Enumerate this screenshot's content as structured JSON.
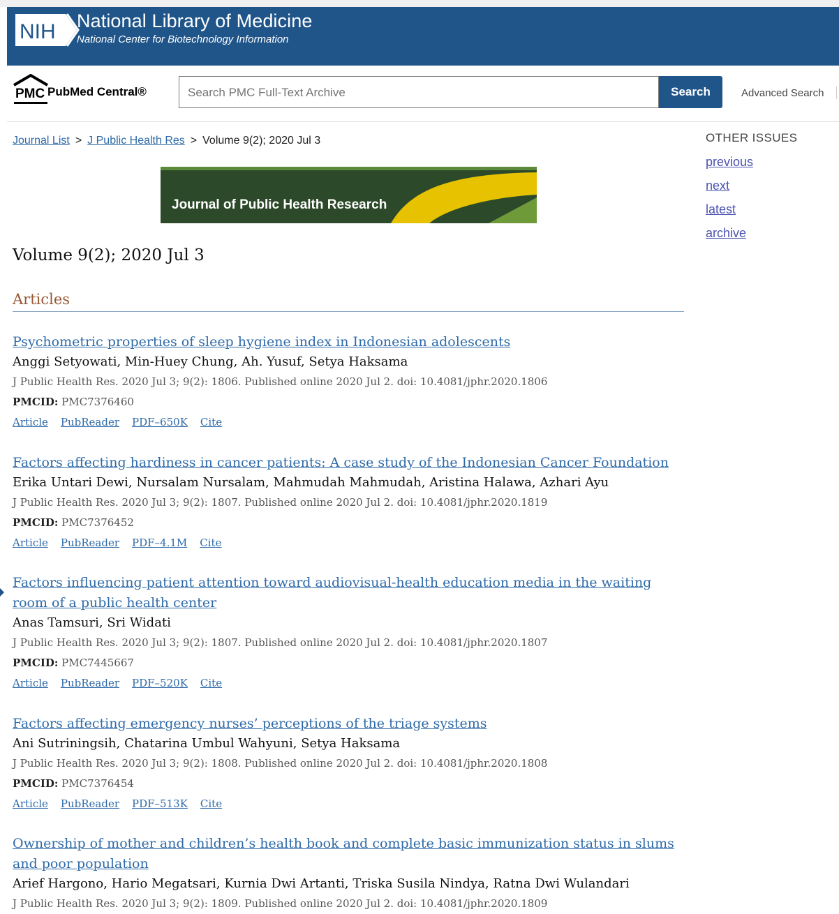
{
  "header": {
    "logo_text": "NIH",
    "title": "National Library of Medicine",
    "subtitle": "National Center for Biotechnology Information"
  },
  "pmc": {
    "logo_abbr": "PMC",
    "logo_name": "PubMed Central®",
    "search_placeholder": "Search PMC Full-Text Archive",
    "search_button": "Search",
    "advanced_search": "Advanced Search"
  },
  "breadcrumb": {
    "journal_list": "Journal List",
    "sep": ">",
    "journal": "J Public Health Res",
    "current": "Volume 9(2);  2020 Jul 3"
  },
  "journal_banner": "Journal of Public Health Research",
  "volume_heading": "Volume 9(2);  2020 Jul 3",
  "articles_heading": "Articles",
  "sidebar": {
    "title": "OTHER ISSUES",
    "links": [
      "previous",
      "next",
      "latest",
      "archive"
    ]
  },
  "articles": [
    {
      "title": "Psychometric properties of sleep hygiene index in Indonesian adolescents",
      "authors": "Anggi Setyowati, Min-Huey Chung, Ah. Yusuf, Setya Haksama",
      "citation": "J Public Health Res. 2020 Jul 3; 9(2): 1806. Published online 2020 Jul 2. doi: 10.4081/jphr.2020.1806",
      "pmcid_label": "PMCID:",
      "pmcid": "PMC7376460",
      "links": [
        "Article",
        "PubReader",
        "PDF–650K",
        "Cite"
      ]
    },
    {
      "title": "Factors affecting hardiness in cancer patients: A case study of the Indonesian Cancer Foundation",
      "authors": "Erika Untari Dewi, Nursalam Nursalam, Mahmudah Mahmudah, Aristina Halawa, Azhari Ayu",
      "citation": "J Public Health Res. 2020 Jul 3; 9(2): 1807. Published online 2020 Jul 2. doi: 10.4081/jphr.2020.1819",
      "pmcid_label": "PMCID:",
      "pmcid": "PMC7376452",
      "links": [
        "Article",
        "PubReader",
        "PDF–4.1M",
        "Cite"
      ]
    },
    {
      "title": "Factors influencing patient attention toward audiovisual-health education media in the waiting room of a public health center",
      "authors": "Anas Tamsuri, Sri Widati",
      "citation": "J Public Health Res. 2020 Jul 3; 9(2): 1807. Published online 2020 Jul 2. doi: 10.4081/jphr.2020.1807",
      "pmcid_label": "PMCID:",
      "pmcid": "PMC7445667",
      "links": [
        "Article",
        "PubReader",
        "PDF–520K",
        "Cite"
      ]
    },
    {
      "title": "Factors affecting emergency nurses’ perceptions of the triage systems",
      "authors": "Ani Sutriningsih, Chatarina Umbul Wahyuni, Setya Haksama",
      "citation": "J Public Health Res. 2020 Jul 3; 9(2): 1808. Published online 2020 Jul 2. doi: 10.4081/jphr.2020.1808",
      "pmcid_label": "PMCID:",
      "pmcid": "PMC7376454",
      "links": [
        "Article",
        "PubReader",
        "PDF–513K",
        "Cite"
      ]
    },
    {
      "title": "Ownership of mother and children’s health book and complete basic immunization status in slums and poor population",
      "authors": "Arief Hargono, Hario Megatsari, Kurnia Dwi Artanti, Triska Susila Nindya, Ratna Dwi Wulandari",
      "citation": "J Public Health Res. 2020 Jul 3; 9(2): 1809. Published online 2020 Jul 2. doi: 10.4081/jphr.2020.1809"
    }
  ]
}
